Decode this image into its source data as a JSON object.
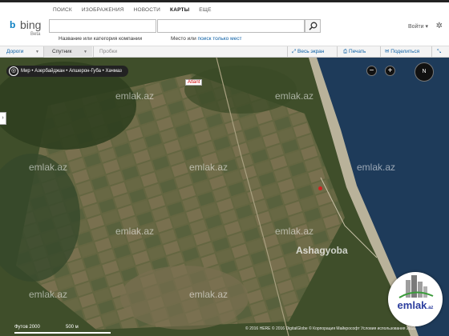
{
  "nav": [
    "ПОИСК",
    "ИЗОБРАЖЕНИЯ",
    "НОВОСТИ",
    "КАРТЫ",
    "ЕЩЕ"
  ],
  "nav_active": "КАРТЫ",
  "logo": {
    "mark": "b",
    "word": "bing",
    "beta": "Beta"
  },
  "search": {
    "what_hint": "Название или категория компании",
    "where_hint_prefix": "Место или ",
    "where_hint_link": "поиск только мест"
  },
  "header": {
    "signin": "Войти ▾",
    "settings_icon": "gear-icon"
  },
  "toolbar": {
    "roads": "Дороги",
    "satellite": "Спутник",
    "traffic": "Пробки",
    "fullscreen": "Весь экран",
    "print": "Печать",
    "share": "Поделиться"
  },
  "map": {
    "breadcrumb": "Мир • Азербайджан • Апшерон-Губа • Хачмаз",
    "poi_label": "Atlant",
    "place_name": "Ashagyoba",
    "watermark": "emlak.az",
    "scale_left": "Футов 2000",
    "scale_right": "500 м",
    "copyright": "© 2016 HERE   © 2016 DigitalGlobe   © Корпорация Майкрософт   Условия использования 2016",
    "compass_label": "N",
    "zoom_out": "−",
    "zoom_in": "+"
  },
  "emlak_logo": {
    "word": "emlak",
    "suffix": ".az"
  },
  "colors": {
    "accent": "#0b5fa5",
    "sea": "#1e3b5a",
    "land": "#5a6b3c",
    "emlak_blue": "#2c3e9e"
  }
}
